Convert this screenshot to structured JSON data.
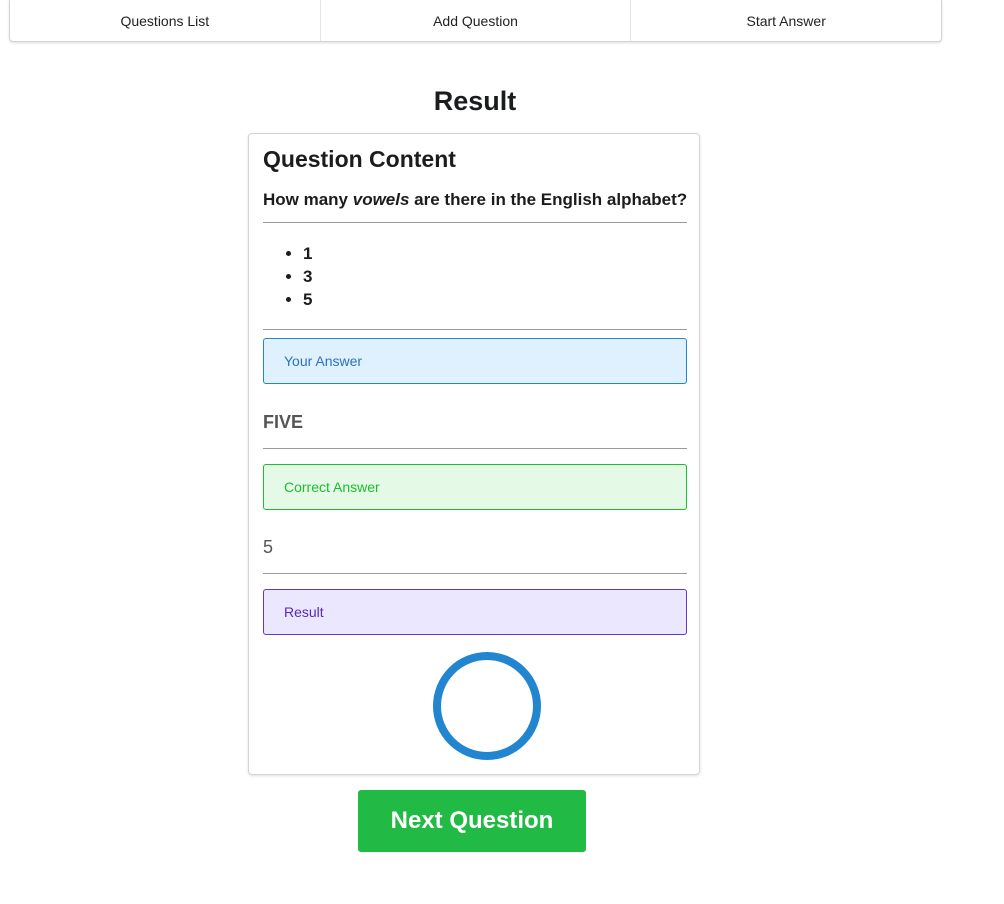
{
  "nav": {
    "items": [
      {
        "label": "Questions List"
      },
      {
        "label": "Add Question"
      },
      {
        "label": "Start Answer"
      }
    ]
  },
  "page": {
    "title": "Result"
  },
  "card": {
    "heading": "Question Content",
    "question": {
      "prefix": "How many ",
      "emphasis": "vowels",
      "suffix": " are there in the English alphabet?"
    },
    "options": [
      "1",
      "3",
      "5"
    ],
    "your_answer": {
      "label": "Your Answer",
      "value": "FIVE"
    },
    "correct_answer": {
      "label": "Correct Answer",
      "value": "5"
    },
    "result": {
      "label": "Result",
      "icon": "circle-outline-icon"
    }
  },
  "actions": {
    "next_label": "Next Question"
  },
  "colors": {
    "blue": "#2185d0",
    "green": "#21ba45",
    "purple": "#6435c9"
  }
}
